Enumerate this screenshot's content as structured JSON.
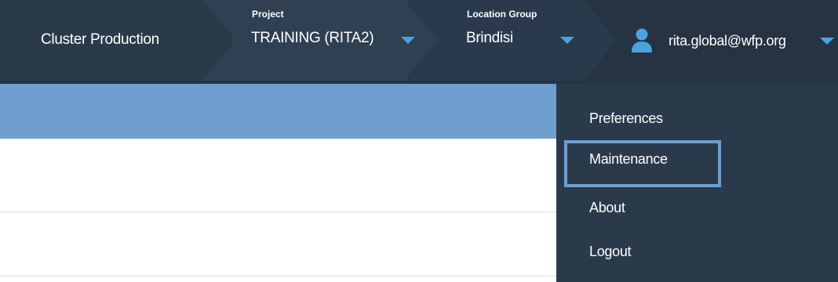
{
  "header": {
    "cluster": {
      "label": "Cluster Production"
    },
    "project": {
      "caption": "Project",
      "value": "TRAINING (RITA2)"
    },
    "location_group": {
      "caption": "Location Group",
      "value": "Brindisi"
    },
    "user": {
      "email": "rita.global@wfp.org",
      "icon": "user-icon"
    }
  },
  "user_menu": {
    "items": [
      {
        "label": "Preferences"
      },
      {
        "label": "Maintenance",
        "focused": true
      },
      {
        "label": "About"
      },
      {
        "label": "Logout"
      }
    ]
  },
  "colors": {
    "topbar": "#263342",
    "accent": "#6e9fcf",
    "caret": "#4aa3df",
    "menu_bg": "#2b3a4b"
  }
}
